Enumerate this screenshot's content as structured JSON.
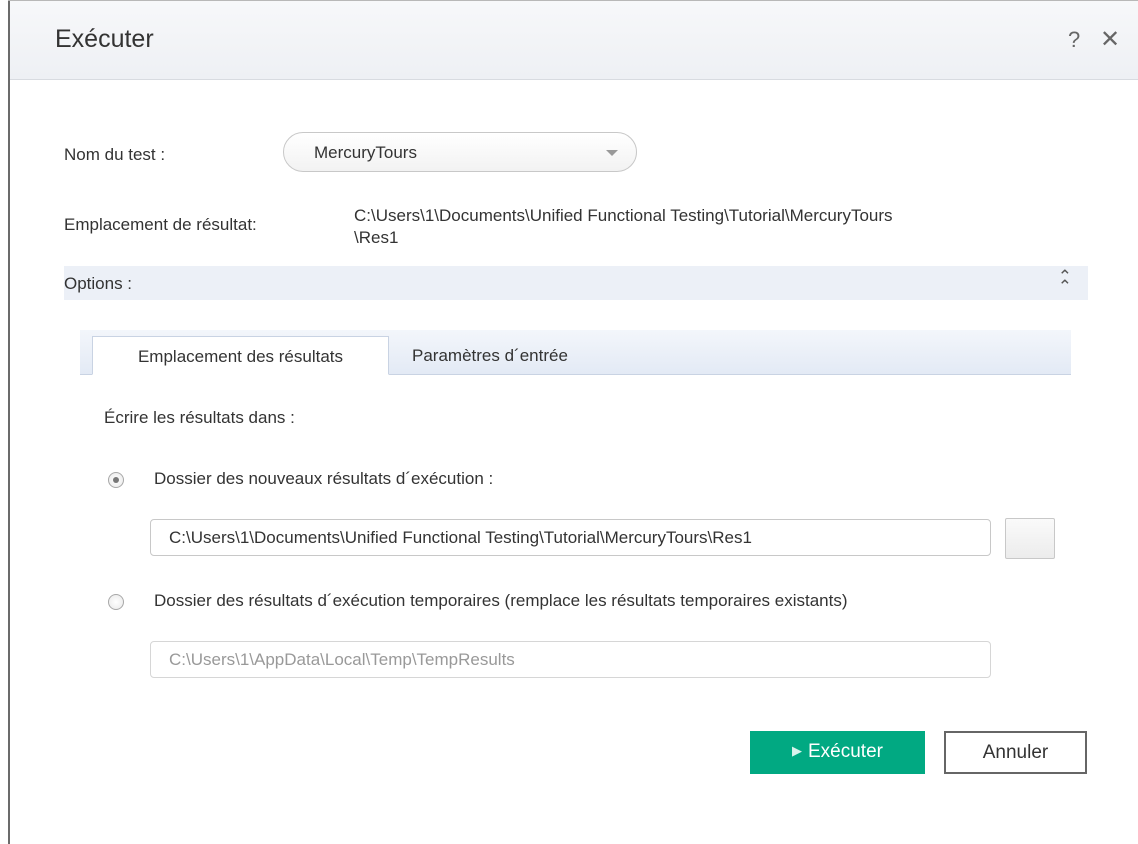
{
  "dialog": {
    "title": "Exécuter",
    "help_icon": "?",
    "close_icon": "✕"
  },
  "form": {
    "test_name_label": "Nom du test :",
    "test_name_value": "MercuryTours",
    "result_location_label": "Emplacement de résultat:",
    "result_location_line1": "C:\\Users\\1\\Documents\\Unified Functional Testing\\Tutorial\\MercuryTours",
    "result_location_line2": "\\Res1"
  },
  "options": {
    "label": "Options :",
    "collapse_icon": "double-chevron-up-icon"
  },
  "tabs": [
    {
      "label": "Emplacement des résultats",
      "active": true
    },
    {
      "label": "Paramètres d´entrée",
      "active": false
    }
  ],
  "results_panel": {
    "write_label": "Écrire les résultats dans :",
    "new_results": {
      "label": "Dossier des nouveaux résultats d´exécution :",
      "selected": true,
      "path": "C:\\Users\\1\\Documents\\Unified Functional Testing\\Tutorial\\MercuryTours\\Res1"
    },
    "temp_results": {
      "label": "Dossier des résultats d´exécution temporaires (remplace les résultats temporaires existants)",
      "selected": false,
      "path": "C:\\Users\\1\\AppData\\Local\\Temp\\TempResults"
    }
  },
  "buttons": {
    "run_label": "Exécuter",
    "cancel_label": "Annuler"
  },
  "colors": {
    "accent": "#01a982",
    "options_bar": "#ecf0f7"
  }
}
